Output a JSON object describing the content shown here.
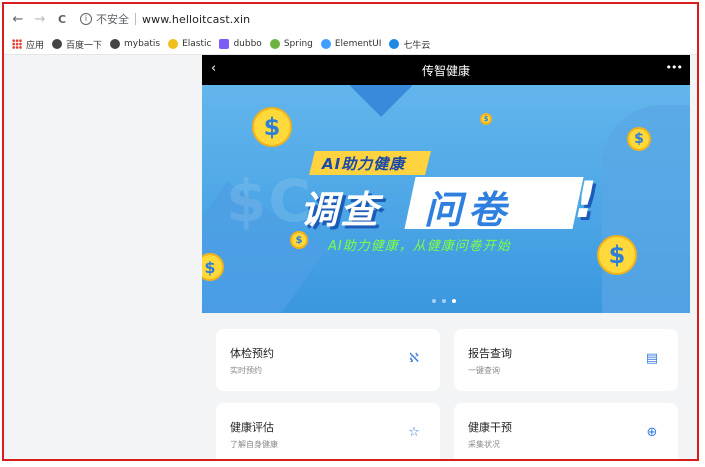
{
  "browser": {
    "nav": {
      "back_icon": "←",
      "forward_icon": "→",
      "reload_icon": "C"
    },
    "security_label": "不安全",
    "url": "www.helloitcast.xin"
  },
  "bookmarks": [
    {
      "label": "应用",
      "icon": "apps-icon",
      "color": "#e33b2e"
    },
    {
      "label": "百度一下",
      "icon": "globe-icon",
      "color": "#444444"
    },
    {
      "label": "mybatis",
      "icon": "globe-icon",
      "color": "#444444"
    },
    {
      "label": "Elastic",
      "icon": "elastic-icon",
      "color": "#f0bf1a"
    },
    {
      "label": "dubbo",
      "icon": "dubbo-icon",
      "color": "#7b5cf5"
    },
    {
      "label": "Spring",
      "icon": "spring-icon",
      "color": "#6db33f"
    },
    {
      "label": "ElementUI",
      "icon": "elementui-icon",
      "color": "#409eff"
    },
    {
      "label": "七牛云",
      "icon": "qiniu-icon",
      "color": "#1e88e5"
    }
  ],
  "mobile": {
    "header": {
      "back_icon": "‹",
      "title": "传智健康",
      "more_icon": "•••"
    },
    "banner": {
      "ribbon_text": "AI助力健康",
      "headline_part1": "调查",
      "headline_part2": "问卷",
      "exclaim": "!",
      "subtitle": "AI助力健康，从健康问卷开始",
      "coin_symbol": "$",
      "pages": 3,
      "active_page": 3
    },
    "cards": [
      {
        "title": "体检预约",
        "subtitle": "实时预约",
        "icon": "stethoscope-icon",
        "glyph": "ℵ"
      },
      {
        "title": "报告查询",
        "subtitle": "一键查询",
        "icon": "report-icon",
        "glyph": "▤"
      },
      {
        "title": "健康评估",
        "subtitle": "了解自身健康",
        "icon": "star-icon",
        "glyph": "☆"
      },
      {
        "title": "健康干预",
        "subtitle": "采集状况",
        "icon": "plus-circle-icon",
        "glyph": "⊕"
      }
    ]
  }
}
